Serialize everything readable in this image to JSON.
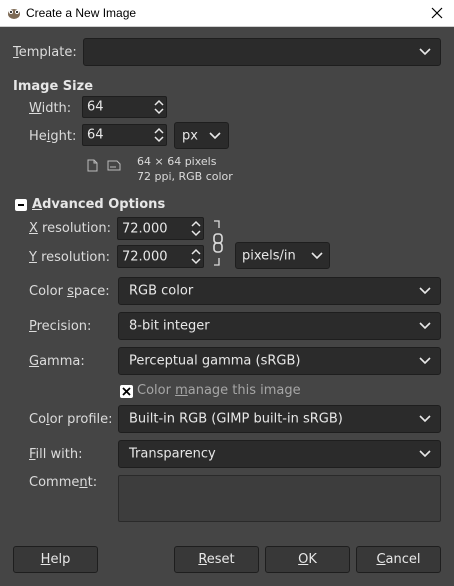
{
  "window": {
    "title": "Create a New Image"
  },
  "template": {
    "label_u": "T",
    "label_rest": "emplate:",
    "value": ""
  },
  "image_size": {
    "heading": "Image Size",
    "width_label_u": "W",
    "width_label_rest": "idth:",
    "width": "64",
    "height_label_pre": "He",
    "height_label_u": "i",
    "height_label_rest": "ght:",
    "height": "64",
    "unit": "px",
    "info_dims": "64 × 64 pixels",
    "info_res": "72 ppi, RGB color"
  },
  "advanced": {
    "heading_u": "A",
    "heading_rest": "dvanced Options",
    "xres_label_u": "X",
    "xres_label_rest": " resolution:",
    "xres": "72.000",
    "yres_label_u": "Y",
    "yres_label_rest": " resolution:",
    "yres": "72.000",
    "res_unit": "pixels/in",
    "color_space_label_pre": "Color ",
    "color_space_label_u": "s",
    "color_space_label_rest": "pace:",
    "color_space": "RGB color",
    "precision_label_u": "P",
    "precision_label_rest": "recision:",
    "precision": "8-bit integer",
    "gamma_label_u": "G",
    "gamma_label_rest": "amma:",
    "gamma": "Perceptual gamma (sRGB)",
    "color_manage_pre": "Color ",
    "color_manage_u": "m",
    "color_manage_rest": "anage this image",
    "color_manage_checked": true,
    "color_profile_label_pre": "Co",
    "color_profile_label_u": "l",
    "color_profile_label_rest": "or profile:",
    "color_profile": "Built-in RGB (GIMP built-in sRGB)",
    "fill_label_u": "F",
    "fill_label_rest": "ill with:",
    "fill": "Transparency",
    "comment_label_pre": "Comme",
    "comment_label_u": "n",
    "comment_label_rest": "t:",
    "comment": ""
  },
  "buttons": {
    "help_u": "H",
    "help_rest": "elp",
    "reset_u": "R",
    "reset_rest": "eset",
    "ok_u": "O",
    "ok_rest": "K",
    "cancel_u": "C",
    "cancel_rest": "ancel"
  },
  "icons": {
    "app": "gimp-icon",
    "close": "close-icon",
    "chevron": "chevron-down-icon",
    "portrait": "portrait-icon",
    "landscape": "landscape-icon",
    "chain": "chain-link-icon"
  }
}
